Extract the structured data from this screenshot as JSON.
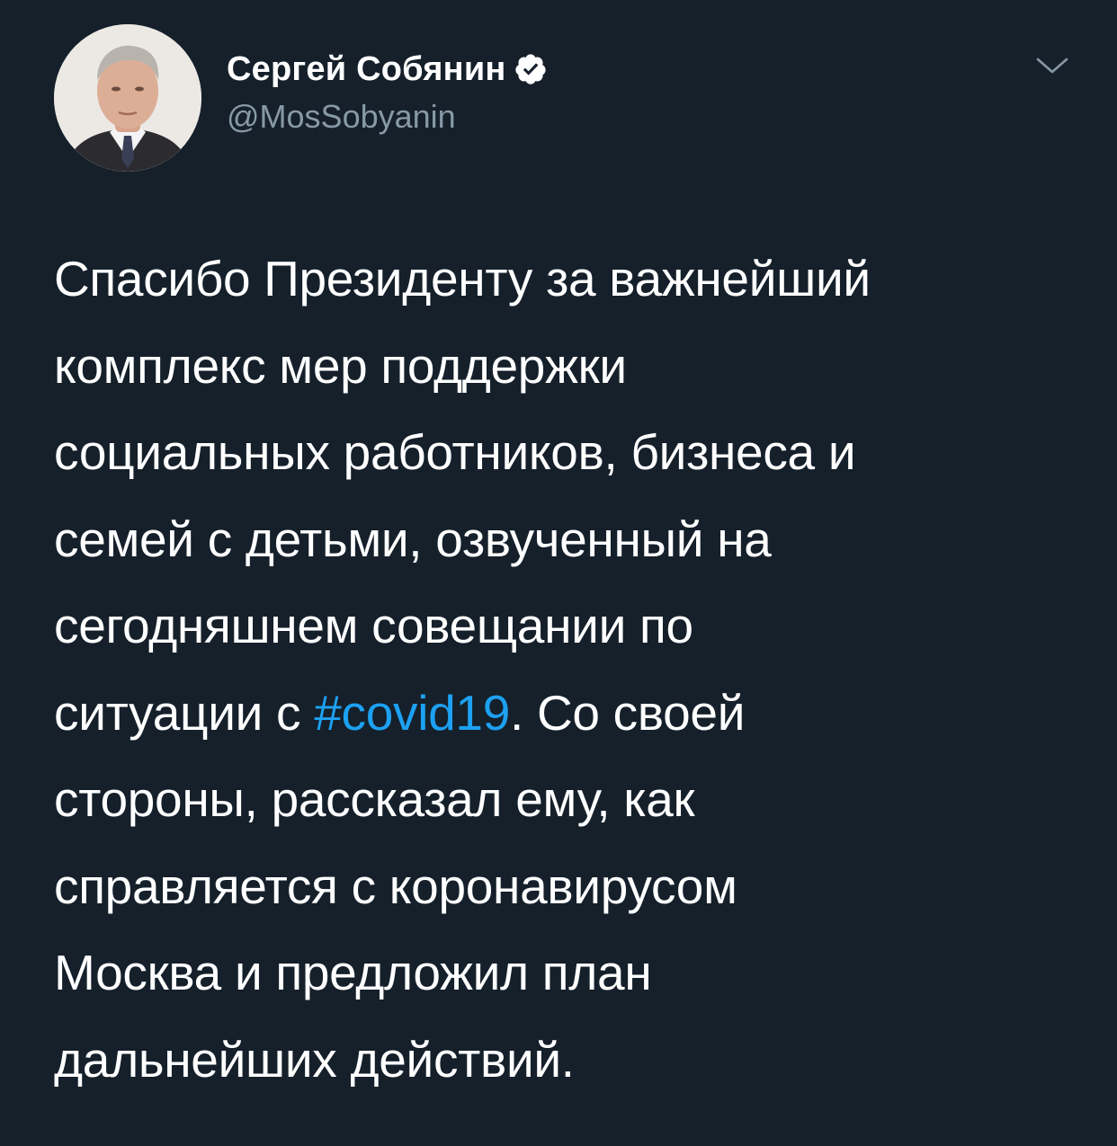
{
  "author": {
    "display_name": "Сергей Собянин",
    "handle": "@MosSobyanin",
    "verified": true
  },
  "icons": {
    "verified": "verified-badge-icon",
    "menu": "chevron-down-icon"
  },
  "tweet": {
    "lines": [
      "Спасибо Президенту за важнейший",
      "комплекс мер поддержки",
      "социальных работников, бизнеса и",
      "семей с детьми, озвученный на",
      "сегодняшнем совещании по"
    ],
    "line6_before": "ситуации с ",
    "hashtag": "#covid19",
    "line6_after": ". Со своей",
    "lines_rest": [
      "стороны, рассказал ему, как",
      "справляется с коронавирусом",
      "Москва и предложил план",
      "дальнейших действий."
    ]
  },
  "colors": {
    "background": "#15202b",
    "text": "#ffffff",
    "secondary_text": "#8899a6",
    "link": "#1da1f2"
  }
}
